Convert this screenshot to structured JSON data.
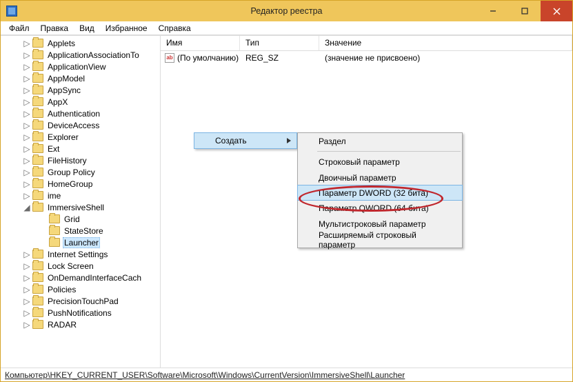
{
  "title": "Редактор реестра",
  "menu": {
    "file": "Файл",
    "edit": "Правка",
    "view": "Вид",
    "fav": "Избранное",
    "help": "Справка"
  },
  "tree": [
    {
      "lvl": 1,
      "label": "Applets",
      "exp": "closed"
    },
    {
      "lvl": 1,
      "label": "ApplicationAssociationTo",
      "exp": "closed"
    },
    {
      "lvl": 1,
      "label": "ApplicationView",
      "exp": "closed"
    },
    {
      "lvl": 1,
      "label": "AppModel",
      "exp": "closed"
    },
    {
      "lvl": 1,
      "label": "AppSync",
      "exp": "closed"
    },
    {
      "lvl": 1,
      "label": "AppX",
      "exp": "closed"
    },
    {
      "lvl": 1,
      "label": "Authentication",
      "exp": "closed"
    },
    {
      "lvl": 1,
      "label": "DeviceAccess",
      "exp": "closed"
    },
    {
      "lvl": 1,
      "label": "Explorer",
      "exp": "closed"
    },
    {
      "lvl": 1,
      "label": "Ext",
      "exp": "closed"
    },
    {
      "lvl": 1,
      "label": "FileHistory",
      "exp": "closed"
    },
    {
      "lvl": 1,
      "label": "Group Policy",
      "exp": "closed"
    },
    {
      "lvl": 1,
      "label": "HomeGroup",
      "exp": "closed"
    },
    {
      "lvl": 1,
      "label": "ime",
      "exp": "closed"
    },
    {
      "lvl": 1,
      "label": "ImmersiveShell",
      "exp": "open"
    },
    {
      "lvl": 2,
      "label": "Grid",
      "exp": "none"
    },
    {
      "lvl": 2,
      "label": "StateStore",
      "exp": "none"
    },
    {
      "lvl": 2,
      "label": "Launcher",
      "exp": "none",
      "selected": true
    },
    {
      "lvl": 1,
      "label": "Internet Settings",
      "exp": "closed"
    },
    {
      "lvl": 1,
      "label": "Lock Screen",
      "exp": "closed"
    },
    {
      "lvl": 1,
      "label": "OnDemandInterfaceCach",
      "exp": "closed"
    },
    {
      "lvl": 1,
      "label": "Policies",
      "exp": "closed"
    },
    {
      "lvl": 1,
      "label": "PrecisionTouchPad",
      "exp": "closed"
    },
    {
      "lvl": 1,
      "label": "PushNotifications",
      "exp": "closed"
    },
    {
      "lvl": 1,
      "label": "RADAR",
      "exp": "closed"
    }
  ],
  "cols": {
    "name": "Имя",
    "type": "Тип",
    "value": "Значение"
  },
  "rows": [
    {
      "name": "(По умолчанию)",
      "type": "REG_SZ",
      "value": "(значение не присвоено)"
    }
  ],
  "ctx1": {
    "create": "Создать"
  },
  "ctx2": {
    "key": "Раздел",
    "sz": "Строковый параметр",
    "bin": "Двоичный параметр",
    "dword": "Параметр DWORD (32 бита)",
    "qword": "Параметр QWORD (64 бита)",
    "multi": "Мультистроковый параметр",
    "expand": "Расширяемый строковый параметр"
  },
  "status": "Компьютер\\HKEY_CURRENT_USER\\Software\\Microsoft\\Windows\\CurrentVersion\\ImmersiveShell\\Launcher"
}
